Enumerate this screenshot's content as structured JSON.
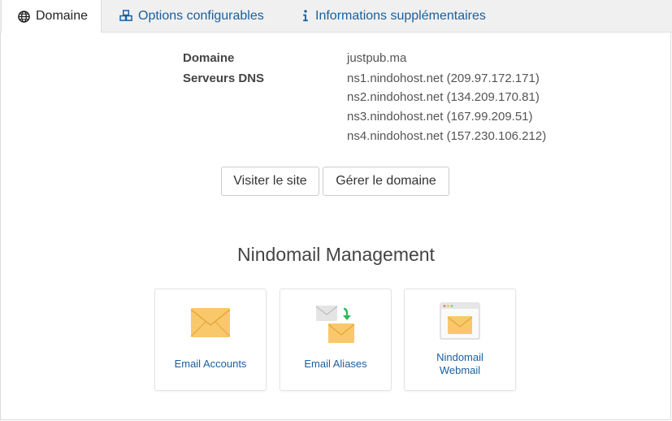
{
  "tabs": [
    {
      "label": "Domaine",
      "icon": "globe-icon",
      "active": true
    },
    {
      "label": "Options configurables",
      "icon": "cubes-icon",
      "active": false
    },
    {
      "label": "Informations supplémentaires",
      "icon": "info-icon",
      "active": false
    }
  ],
  "details": {
    "domain_label": "Domaine",
    "domain_value": "justpub.ma",
    "dns_label": "Serveurs DNS",
    "dns_servers": [
      "ns1.nindohost.net (209.97.172.171)",
      "ns2.nindohost.net (134.209.170.81)",
      "ns3.nindohost.net (167.99.209.51)",
      "ns4.nindohost.net (157.230.106.212)"
    ]
  },
  "buttons": {
    "visit": "Visiter le site",
    "manage": "Gérer le domaine"
  },
  "mail": {
    "title": "Nindomail Management",
    "cards": [
      {
        "label": "Email Accounts",
        "icon": "envelope-icon"
      },
      {
        "label": "Email Aliases",
        "icon": "email-forward-icon"
      },
      {
        "label_line1": "Nindomail",
        "label_line2": "Webmail",
        "icon": "webmail-icon"
      }
    ]
  },
  "colors": {
    "link": "#1a5f9e",
    "envelope": "#f9c86a",
    "arrow": "#2fb85a"
  }
}
